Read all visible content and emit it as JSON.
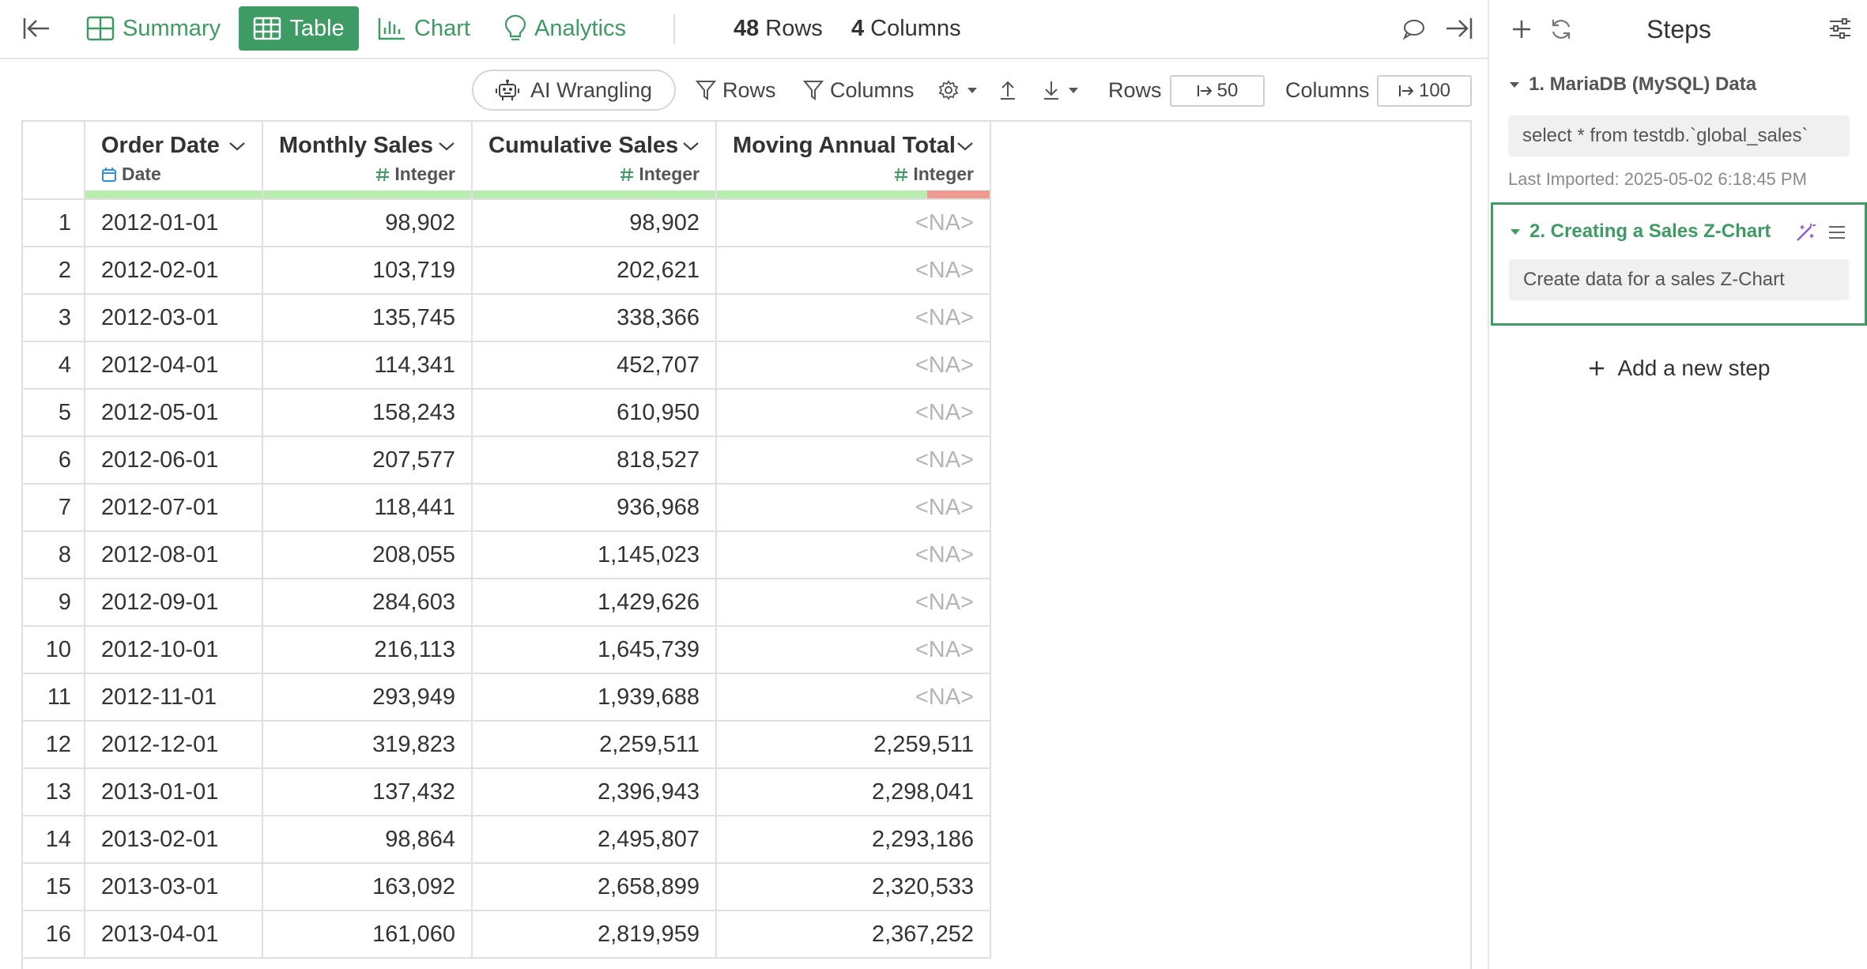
{
  "view_tabs": [
    {
      "label": "Summary"
    },
    {
      "label": "Table"
    },
    {
      "label": "Chart"
    },
    {
      "label": "Analytics"
    }
  ],
  "counts": {
    "rows_value": "48",
    "rows_label": "Rows",
    "cols_value": "4",
    "cols_label": "Columns"
  },
  "toolbar": {
    "ai_label": "AI Wrangling",
    "rows_filter": "Rows",
    "cols_filter": "Columns",
    "rows_limit_label": "Rows",
    "rows_limit_value": "50",
    "cols_limit_label": "Columns",
    "cols_limit_value": "100"
  },
  "table": {
    "columns": [
      {
        "name": "Order Date",
        "type": "Date"
      },
      {
        "name": "Monthly Sales",
        "type": "Integer"
      },
      {
        "name": "Cumulative Sales",
        "type": "Integer"
      },
      {
        "name": "Moving Annual Total",
        "type": "Integer",
        "na_fraction": 0.23
      }
    ],
    "rows": [
      {
        "idx": "1",
        "date": "2012-01-01",
        "monthly": "98,902",
        "cumulative": "98,902",
        "mat": "<NA>"
      },
      {
        "idx": "2",
        "date": "2012-02-01",
        "monthly": "103,719",
        "cumulative": "202,621",
        "mat": "<NA>"
      },
      {
        "idx": "3",
        "date": "2012-03-01",
        "monthly": "135,745",
        "cumulative": "338,366",
        "mat": "<NA>"
      },
      {
        "idx": "4",
        "date": "2012-04-01",
        "monthly": "114,341",
        "cumulative": "452,707",
        "mat": "<NA>"
      },
      {
        "idx": "5",
        "date": "2012-05-01",
        "monthly": "158,243",
        "cumulative": "610,950",
        "mat": "<NA>"
      },
      {
        "idx": "6",
        "date": "2012-06-01",
        "monthly": "207,577",
        "cumulative": "818,527",
        "mat": "<NA>"
      },
      {
        "idx": "7",
        "date": "2012-07-01",
        "monthly": "118,441",
        "cumulative": "936,968",
        "mat": "<NA>"
      },
      {
        "idx": "8",
        "date": "2012-08-01",
        "monthly": "208,055",
        "cumulative": "1,145,023",
        "mat": "<NA>"
      },
      {
        "idx": "9",
        "date": "2012-09-01",
        "monthly": "284,603",
        "cumulative": "1,429,626",
        "mat": "<NA>"
      },
      {
        "idx": "10",
        "date": "2012-10-01",
        "monthly": "216,113",
        "cumulative": "1,645,739",
        "mat": "<NA>"
      },
      {
        "idx": "11",
        "date": "2012-11-01",
        "monthly": "293,949",
        "cumulative": "1,939,688",
        "mat": "<NA>"
      },
      {
        "idx": "12",
        "date": "2012-12-01",
        "monthly": "319,823",
        "cumulative": "2,259,511",
        "mat": "2,259,511"
      },
      {
        "idx": "13",
        "date": "2013-01-01",
        "monthly": "137,432",
        "cumulative": "2,396,943",
        "mat": "2,298,041"
      },
      {
        "idx": "14",
        "date": "2013-02-01",
        "monthly": "98,864",
        "cumulative": "2,495,807",
        "mat": "2,293,186"
      },
      {
        "idx": "15",
        "date": "2013-03-01",
        "monthly": "163,092",
        "cumulative": "2,658,899",
        "mat": "2,320,533"
      },
      {
        "idx": "16",
        "date": "2013-04-01",
        "monthly": "161,060",
        "cumulative": "2,819,959",
        "mat": "2,367,252"
      }
    ]
  },
  "steps_panel": {
    "title": "Steps",
    "steps": [
      {
        "title": "1. MariaDB (MySQL) Data",
        "description": "select * from testdb.`global_sales`",
        "meta": "Last Imported: 2025-05-02 6:18:45 PM"
      },
      {
        "title": "2. Creating a Sales Z-Chart",
        "description": "Create data for a sales Z-Chart"
      }
    ],
    "add_step_label": "Add a new step"
  },
  "colors": {
    "accent_green": "#3d9b63",
    "quality_ok": "#b9ecb0",
    "quality_na": "#ef9a90",
    "na_text": "#b5b5b5",
    "magic_purple": "#8e5bd6"
  }
}
